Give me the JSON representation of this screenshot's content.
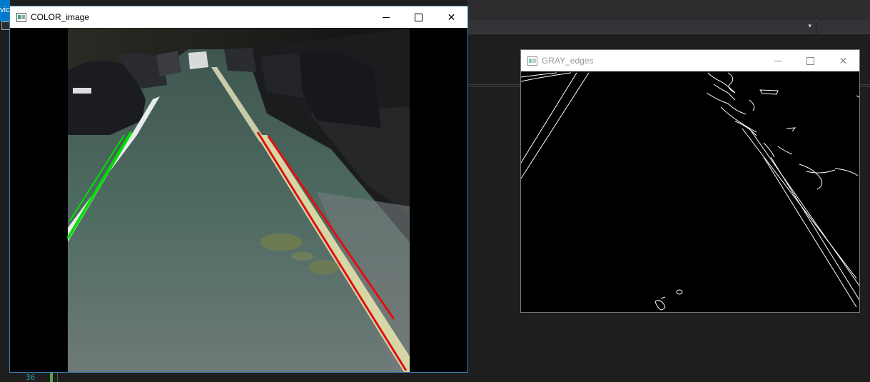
{
  "ide": {
    "accent_label": "vic",
    "line_number": "36"
  },
  "color_window": {
    "title": "COLOR_image",
    "left_lane_color": "#00e000",
    "right_lane_color": "#e01010"
  },
  "gray_window": {
    "title": "GRAY_edges"
  },
  "icons": {
    "app": "opencv-window-icon",
    "minimize": "minimize-icon",
    "maximize": "maximize-icon",
    "close": "close-icon"
  }
}
